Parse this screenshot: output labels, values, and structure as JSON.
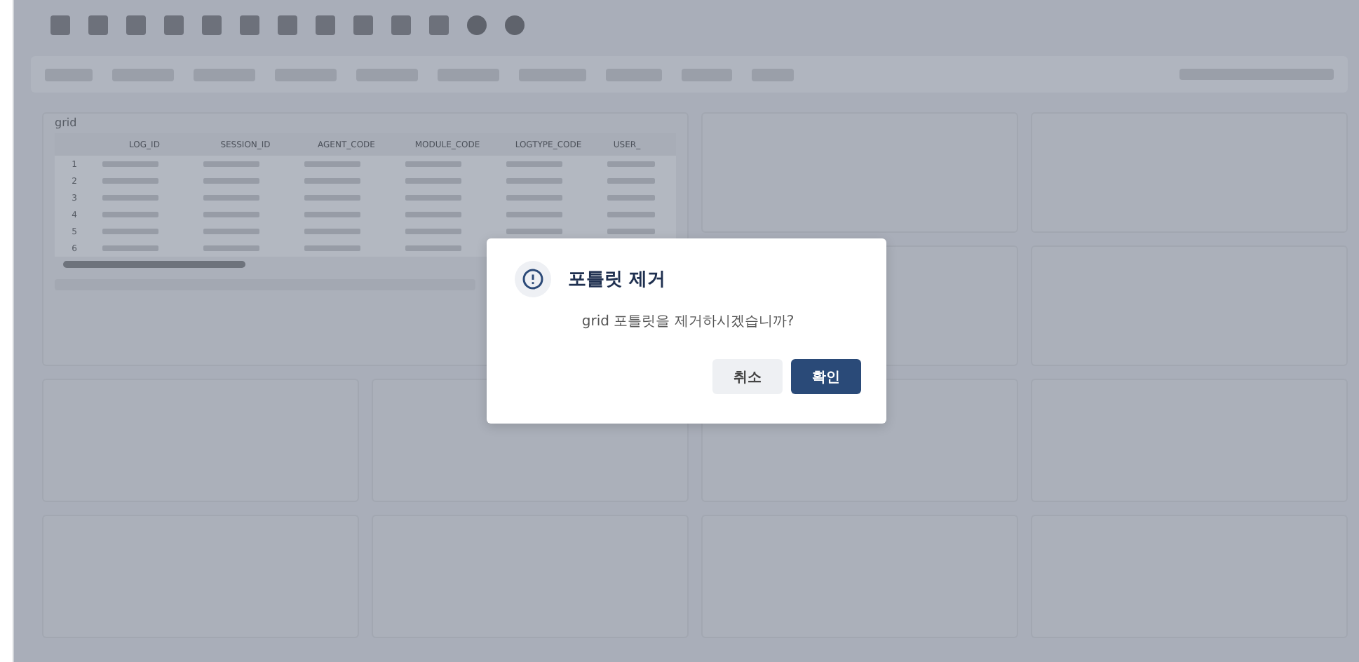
{
  "grid": {
    "title": "grid",
    "columns": [
      "LOG_ID",
      "SESSION_ID",
      "AGENT_CODE",
      "MODULE_CODE",
      "LOGTYPE_CODE",
      "USER_"
    ],
    "row_numbers": [
      "1",
      "2",
      "3",
      "4",
      "5",
      "6"
    ]
  },
  "dialog": {
    "title": "포틀릿 제거",
    "message": "grid 포틀릿을 제거하시겠습니까?",
    "buttons": [
      {
        "label": "취소",
        "kind": "secondary"
      },
      {
        "label": "확인",
        "kind": "primary"
      }
    ]
  }
}
